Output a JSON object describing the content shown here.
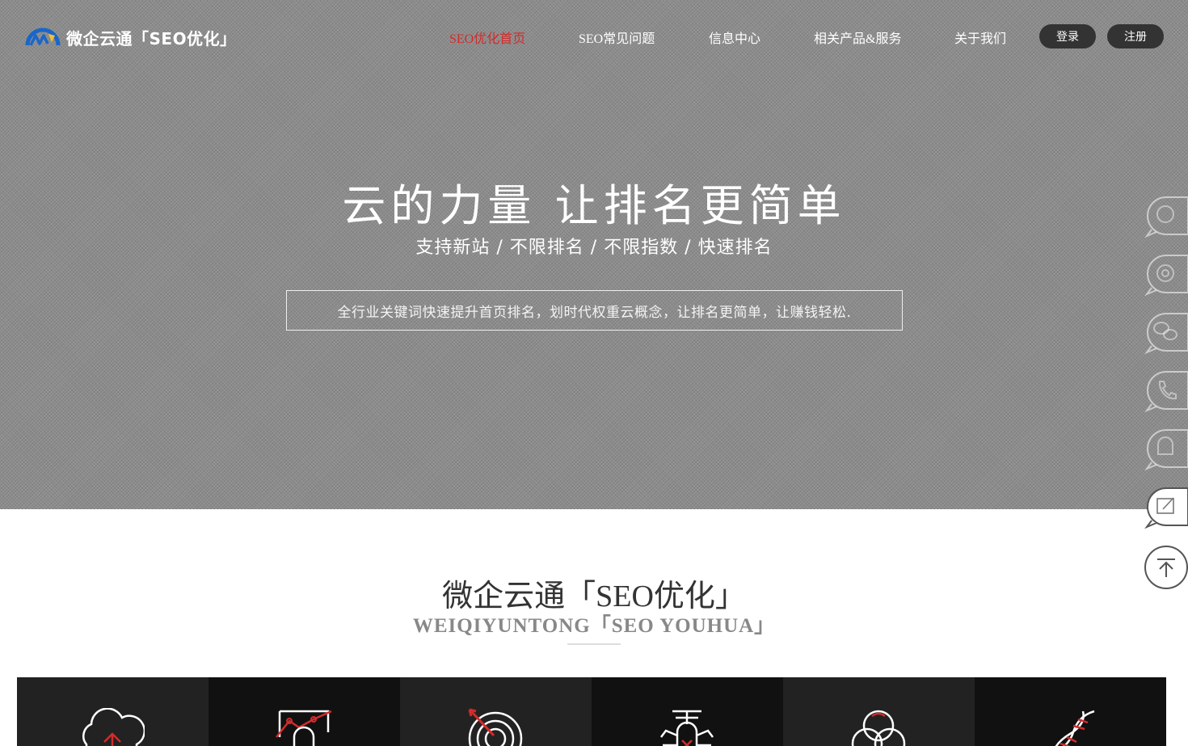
{
  "header": {
    "logo_text": "微企云通「SEO优化」",
    "nav": [
      {
        "label": "SEO优化首页",
        "active": true
      },
      {
        "label": "SEO常见问题",
        "active": false
      },
      {
        "label": "信息中心",
        "active": false
      },
      {
        "label": "相关产品&服务",
        "active": false
      },
      {
        "label": "关于我们",
        "active": false
      }
    ],
    "login_label": "登录",
    "register_label": "注册"
  },
  "hero": {
    "title": "云的力量 让排名更简单",
    "subtitle": "支持新站 / 不限排名 / 不限指数 / 快速排名",
    "box_text": "全行业关键词快速提升首页排名，划时代权重云概念，让排名更简单，让赚钱轻松."
  },
  "side_tools": [
    {
      "icon": "qq-chat-icon"
    },
    {
      "icon": "qq-service-icon"
    },
    {
      "icon": "wechat-icon"
    },
    {
      "icon": "phone-icon"
    },
    {
      "icon": "message-bubble-icon"
    },
    {
      "icon": "edit-feedback-icon"
    },
    {
      "icon": "back-to-top-icon"
    }
  ],
  "section": {
    "title": "微企云通「SEO优化」",
    "subtitle": "WEIQIYUNTONG「SEO YOUHUA」"
  },
  "tiles": [
    {
      "icon": "cloud-upload-icon"
    },
    {
      "icon": "chart-person-icon"
    },
    {
      "icon": "target-icon"
    },
    {
      "icon": "bug-icon"
    },
    {
      "icon": "venn-circles-icon"
    },
    {
      "icon": "dna-icon"
    }
  ],
  "colors": {
    "accent": "#d42b2b",
    "hero_bg": "#8c8c8c",
    "pill_bg": "#333333",
    "tile_dark": "#222222",
    "tile_darker": "#111111"
  }
}
